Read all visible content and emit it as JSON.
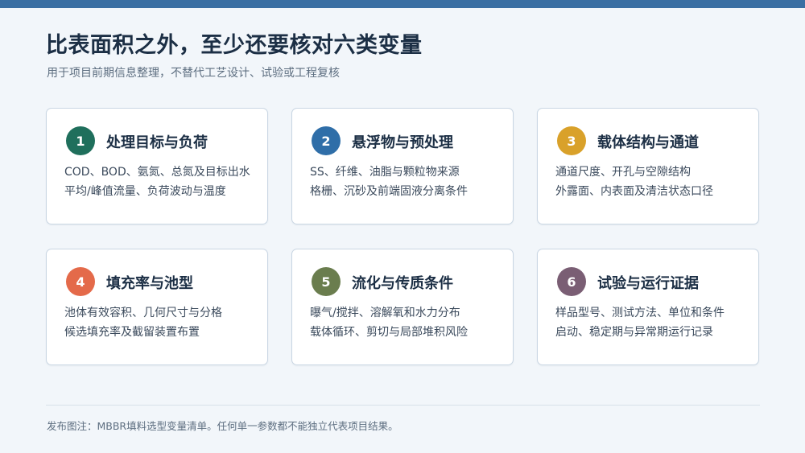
{
  "header": {
    "title": "比表面积之外，至少还要核对六类变量",
    "subtitle": "用于项目前期信息整理，不替代工艺设计、试验或工程复核"
  },
  "cards": [
    {
      "number": "1",
      "color": "#1f6f5c",
      "title": "处理目标与负荷",
      "lines": [
        "COD、BOD、氨氮、总氮及目标出水",
        "平均/峰值流量、负荷波动与温度"
      ]
    },
    {
      "number": "2",
      "color": "#2f6ea8",
      "title": "悬浮物与预处理",
      "lines": [
        "SS、纤维、油脂与颗粒物来源",
        "格栅、沉砂及前端固液分离条件"
      ]
    },
    {
      "number": "3",
      "color": "#d9a12a",
      "title": "载体结构与通道",
      "lines": [
        "通道尺度、开孔与空隙结构",
        "外露面、内表面及清洁状态口径"
      ]
    },
    {
      "number": "4",
      "color": "#e46a4a",
      "title": "填充率与池型",
      "lines": [
        "池体有效容积、几何尺寸与分格",
        "候选填充率及截留装置布置"
      ]
    },
    {
      "number": "5",
      "color": "#6a7d4e",
      "title": "流化与传质条件",
      "lines": [
        "曝气/搅拌、溶解氧和水力分布",
        "载体循环、剪切与局部堆积风险"
      ]
    },
    {
      "number": "6",
      "color": "#7a5e74",
      "title": "试验与运行证据",
      "lines": [
        "样品型号、测试方法、单位和条件",
        "启动、稳定期与异常期运行记录"
      ]
    }
  ],
  "footer": {
    "note": "发布图注：MBBR填料选型变量清单。任何单一参数都不能独立代表项目结果。"
  }
}
